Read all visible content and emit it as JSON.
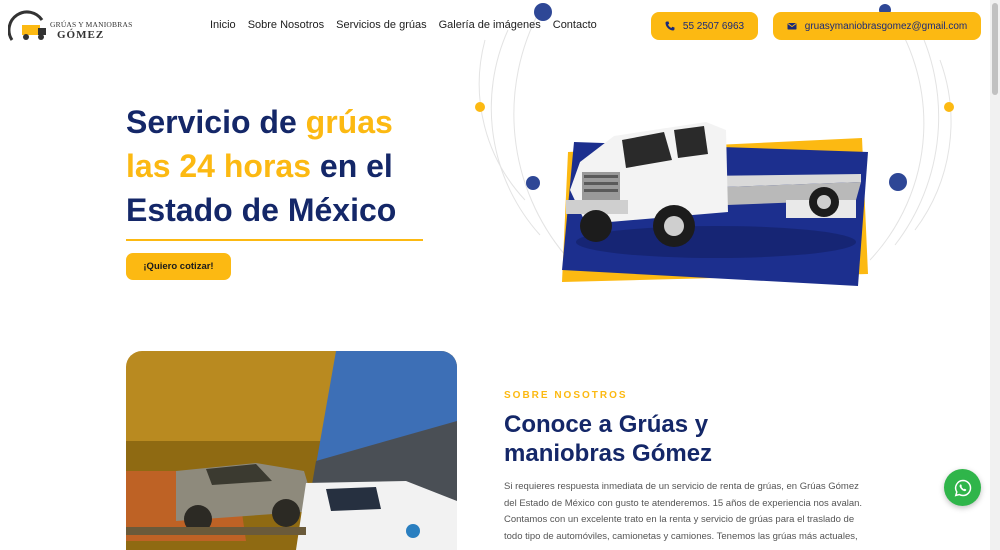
{
  "brand": {
    "line1": "GRÚAS Y MANIOBRAS",
    "line2": "GÓMEZ",
    "colors": {
      "navy": "#142768",
      "yellow": "#fcb912",
      "whatsapp": "#2fb54a"
    }
  },
  "nav": {
    "items": [
      "Inicio",
      "Sobre Nosotros",
      "Servicios de grúas",
      "Galería de imágenes",
      "Contacto"
    ]
  },
  "contact": {
    "phone": "55 2507 6963",
    "phone_icon": "phone-icon",
    "email": "gruasymaniobrasgomez@gmail.com",
    "email_icon": "envelope-icon"
  },
  "hero": {
    "title_part1": "Servicio de ",
    "title_accent1": "grúas",
    "title_accent2": "las 24 horas",
    "title_part2": " en el Estado de México",
    "cta": "¡Quiero cotizar!"
  },
  "about": {
    "eyebrow": "SOBRE NOSOTROS",
    "title": "Conoce a Grúas y maniobras Gómez",
    "body": "Si requieres respuesta inmediata de un servicio de renta de grúas, en Grúas Gómez del Estado de México con gusto te atenderemos. 15 años de experiencia nos avalan. Contamos con un excelente trato en la renta y servicio de grúas para el traslado de todo tipo de automóviles, camionetas y camiones. Tenemos las grúas más actuales,"
  },
  "floating": {
    "whatsapp_icon": "whatsapp-icon"
  }
}
